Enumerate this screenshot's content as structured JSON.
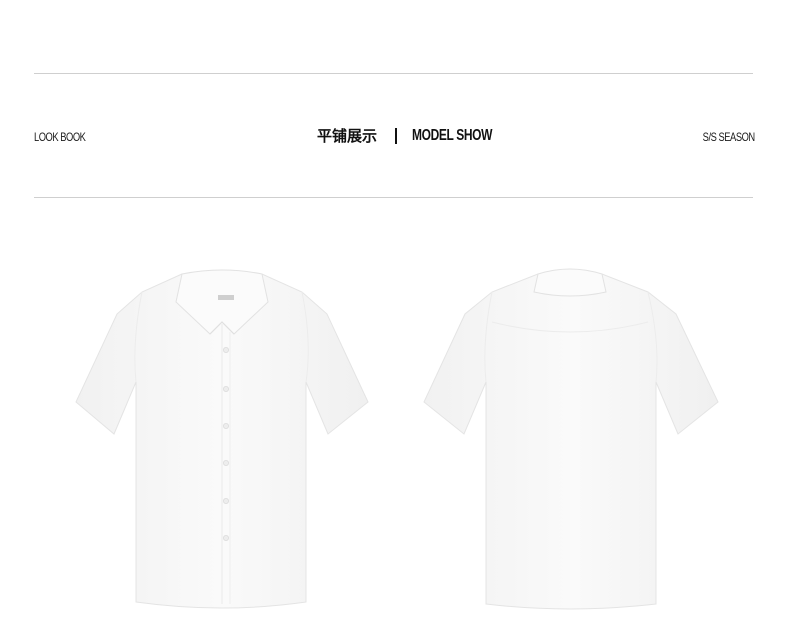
{
  "header": {
    "left_label": "LOOK BOOK",
    "title_cn": "平铺展示",
    "title_separator": "|",
    "title_en": "MODEL SHOW",
    "right_label": "S/S SEASON"
  },
  "gallery": {
    "items": [
      {
        "view": "front",
        "icon": "shirt-front-image"
      },
      {
        "view": "back",
        "icon": "shirt-back-image"
      }
    ]
  },
  "colors": {
    "background": "#ffffff",
    "rule": "#cfcfcf",
    "text": "#111111",
    "shirt": "#f7f7f7",
    "shirt_shadow": "#e6e6e6"
  }
}
